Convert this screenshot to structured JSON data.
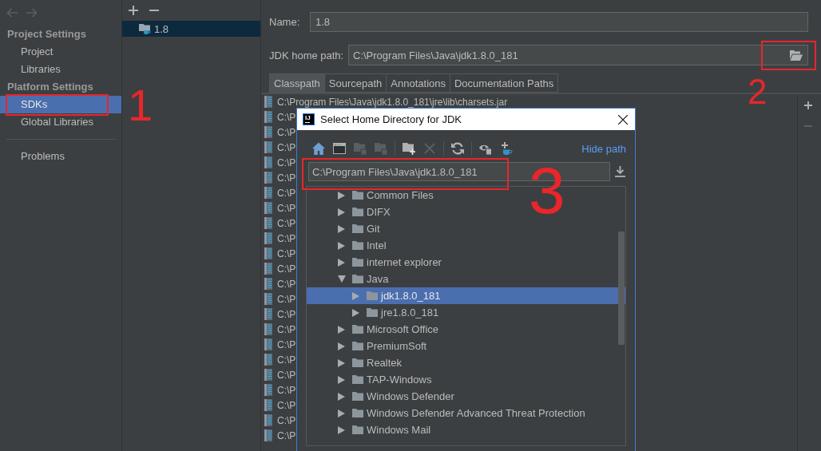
{
  "nav": [
    {
      "kind": "back",
      "disabled": true
    },
    {
      "kind": "forward",
      "disabled": true
    }
  ],
  "sidebar": {
    "sections": [
      {
        "title": "Project Settings",
        "items": [
          {
            "label": "Project",
            "selected": false
          },
          {
            "label": "Libraries",
            "selected": false
          }
        ]
      },
      {
        "title": "Platform Settings",
        "items": [
          {
            "label": "SDKs",
            "selected": true
          },
          {
            "label": "Global Libraries",
            "selected": false
          }
        ]
      }
    ],
    "footer_items": [
      {
        "label": "Problems",
        "selected": false
      }
    ]
  },
  "sdk_panel": {
    "toolbar": [
      {
        "kind": "add",
        "disabled": false
      },
      {
        "kind": "remove",
        "disabled": false
      }
    ],
    "items": [
      {
        "label": "1.8",
        "selected": true
      }
    ]
  },
  "form": {
    "name": {
      "label": "Name:",
      "value": "1.8"
    },
    "jdk_home": {
      "label": "JDK home path:",
      "value": "C:\\Program Files\\Java\\jdk1.8.0_181"
    }
  },
  "tabs": [
    {
      "label": "Classpath",
      "selected": true
    },
    {
      "label": "Sourcepath",
      "selected": false
    },
    {
      "label": "Annotations",
      "selected": false
    },
    {
      "label": "Documentation Paths",
      "selected": false
    }
  ],
  "classpath": {
    "rows": [
      {
        "text": "C:\\Program Files\\Java\\jdk1.8.0_181\\jre\\lib\\charsets.jar",
        "selected": false
      },
      {
        "text": "C:\\P",
        "selected": false
      },
      {
        "text": "C:\\P",
        "selected": false
      },
      {
        "text": "C:\\P",
        "selected": false
      },
      {
        "text": "C:\\P",
        "selected": false
      },
      {
        "text": "C:\\P",
        "selected": false
      },
      {
        "text": "C:\\P",
        "selected": false
      },
      {
        "text": "C:\\P",
        "selected": false
      },
      {
        "text": "C:\\P",
        "selected": false
      },
      {
        "text": "C:\\P",
        "selected": false
      },
      {
        "text": "C:\\P",
        "selected": false
      },
      {
        "text": "C:\\P",
        "selected": false
      },
      {
        "text": "C:\\P",
        "selected": false
      },
      {
        "text": "C:\\P",
        "selected": false
      },
      {
        "text": "C:\\P",
        "selected": false
      },
      {
        "text": "C:\\P",
        "selected": false
      },
      {
        "text": "C:\\P",
        "selected": false
      },
      {
        "text": "C:\\P",
        "selected": false
      },
      {
        "text": "C:\\P",
        "selected": false
      },
      {
        "text": "C:\\P",
        "selected": false
      },
      {
        "text": "C:\\P",
        "selected": false
      },
      {
        "text": "C:\\P",
        "selected": false
      },
      {
        "text": "C:\\P",
        "selected": false
      }
    ],
    "toolbar": [
      {
        "kind": "add",
        "disabled": false
      },
      {
        "kind": "remove",
        "disabled": true
      }
    ]
  },
  "dialog": {
    "logo": "IJ",
    "title": "Select Home Directory for JDK",
    "toolbar_groups": [
      {
        "buttons": [
          {
            "kind": "home",
            "disabled": false
          },
          {
            "kind": "desktop",
            "disabled": false
          },
          {
            "kind": "project",
            "disabled": true
          },
          {
            "kind": "module",
            "disabled": true
          }
        ]
      },
      {
        "buttons": [
          {
            "kind": "new_folder",
            "disabled": false
          },
          {
            "kind": "delete",
            "disabled": true
          }
        ]
      },
      {
        "buttons": [
          {
            "kind": "refresh",
            "disabled": false
          }
        ]
      },
      {
        "buttons": [
          {
            "kind": "show_hidden",
            "disabled": false
          },
          {
            "kind": "add_jdk",
            "disabled": false
          }
        ]
      }
    ],
    "hide_path_link": "Hide path",
    "path": "C:\\Program Files\\Java\\jdk1.8.0_181",
    "tree": [
      {
        "label": "Common Files",
        "expanded": false,
        "selected": false
      },
      {
        "label": "DIFX",
        "expanded": false,
        "selected": false
      },
      {
        "label": "Git",
        "expanded": false,
        "selected": false
      },
      {
        "label": "Intel",
        "expanded": false,
        "selected": false
      },
      {
        "label": "internet explorer",
        "expanded": false,
        "selected": false
      },
      {
        "label": "Java",
        "expanded": true,
        "selected": false,
        "children": [
          {
            "label": "jdk1.8.0_181",
            "expanded": false,
            "selected": true
          },
          {
            "label": "jre1.8.0_181",
            "expanded": false,
            "selected": false
          }
        ]
      },
      {
        "label": "Microsoft Office",
        "expanded": false,
        "selected": false
      },
      {
        "label": "PremiumSoft",
        "expanded": false,
        "selected": false
      },
      {
        "label": "Realtek",
        "expanded": false,
        "selected": false
      },
      {
        "label": "TAP-Windows",
        "expanded": false,
        "selected": false
      },
      {
        "label": "Windows Defender",
        "expanded": false,
        "selected": false
      },
      {
        "label": "Windows Defender Advanced Threat Protection",
        "expanded": false,
        "selected": false
      },
      {
        "label": "Windows Mail",
        "expanded": false,
        "selected": false
      }
    ]
  },
  "annotations": [
    {
      "label": "1"
    },
    {
      "label": "2"
    },
    {
      "label": "3"
    }
  ]
}
